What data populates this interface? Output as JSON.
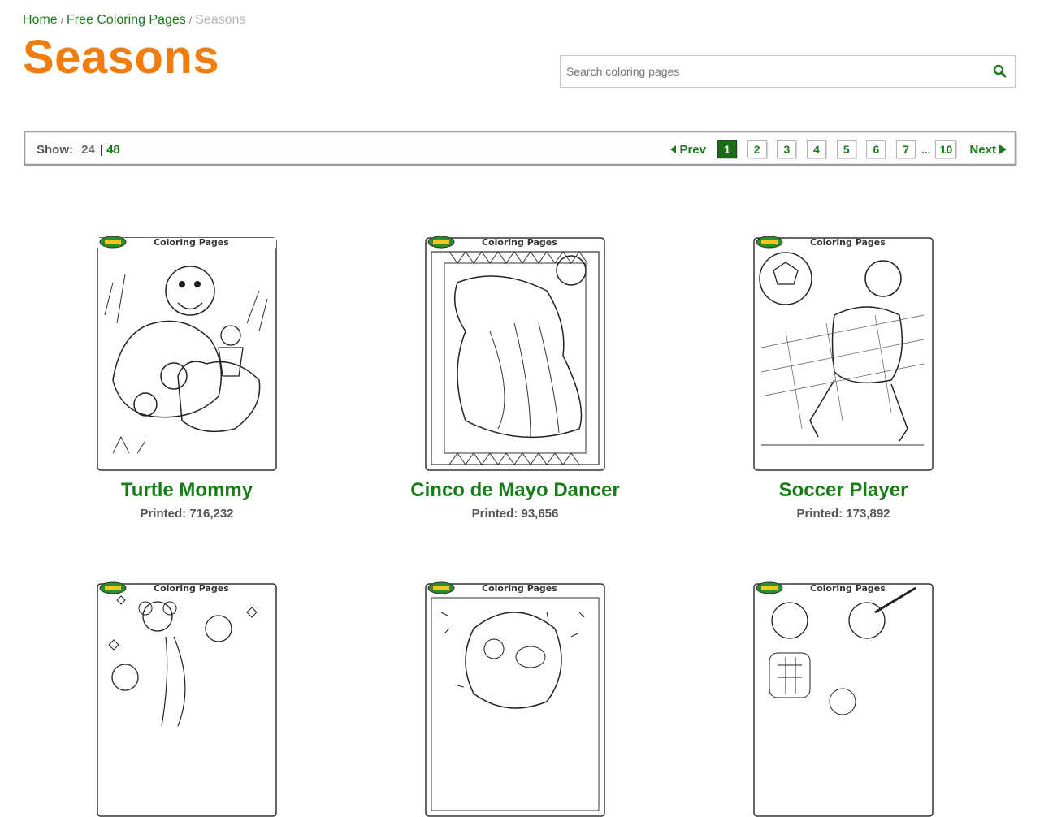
{
  "breadcrumb": {
    "home": "Home",
    "section": "Free Coloring Pages",
    "current": "Seasons",
    "separator": "/"
  },
  "page_title": "Seasons",
  "search": {
    "placeholder": "Search coloring pages",
    "value": "",
    "icon": "magnifier-icon"
  },
  "pager": {
    "show_label": "Show:",
    "show_options": [
      "24",
      "48"
    ],
    "show_separator": "|",
    "prev_label": "Prev",
    "next_label": "Next",
    "pages": [
      "1",
      "2",
      "3",
      "4",
      "5",
      "6",
      "7"
    ],
    "ellipsis": "...",
    "last_page": "10",
    "current_page": "1"
  },
  "thumb_header": {
    "brand": "Crayola",
    "label": "Coloring Pages"
  },
  "cards": [
    {
      "title": "Turtle Mommy",
      "printed": "Printed: 716,232"
    },
    {
      "title": "Cinco de Mayo Dancer",
      "printed": "Printed: 93,656"
    },
    {
      "title": "Soccer Player",
      "printed": "Printed: 173,892"
    },
    {
      "title": "",
      "printed": ""
    },
    {
      "title": "",
      "printed": ""
    },
    {
      "title": "",
      "printed": ""
    }
  ],
  "colors": {
    "accent_orange": "#f07d10",
    "link_green": "#1b7b1b",
    "active_page": "#1b6b1b"
  }
}
